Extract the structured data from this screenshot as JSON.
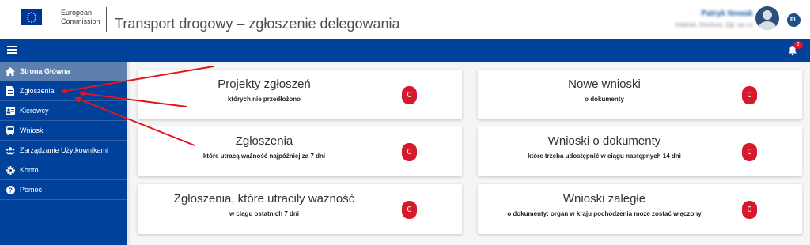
{
  "header": {
    "org_line1": "European",
    "org_line2": "Commission",
    "title": "Transport drogowy – zgłoszenie delegowania",
    "user_name": "Patryk Nowak",
    "user_sub": "Imbirek, Kierkow, Zgl. se.r.o",
    "language": "PL"
  },
  "topbar": {
    "notification_count": "2"
  },
  "sidebar": {
    "items": [
      {
        "label": "Strona Główna",
        "icon": "home-icon"
      },
      {
        "label": "Zgłoszenia",
        "icon": "document-icon"
      },
      {
        "label": "Kierowcy",
        "icon": "id-card-icon"
      },
      {
        "label": "Wnioski",
        "icon": "bus-icon"
      },
      {
        "label": "Zarządzanie Użytkownikami",
        "icon": "users-icon"
      },
      {
        "label": "Konto",
        "icon": "gear-icon"
      },
      {
        "label": "Pomoc",
        "icon": "help-icon"
      }
    ]
  },
  "cards": [
    {
      "title": "Projekty zgłoszeń",
      "sub": "których nie przedłożono",
      "count": "0"
    },
    {
      "title": "Nowe wnioski",
      "sub": "o dokumenty",
      "count": "0"
    },
    {
      "title": "Zgłoszenia",
      "sub": "które utracą ważność najpóźniej za 7 dni",
      "count": "0"
    },
    {
      "title": "Wnioski o dokumenty",
      "sub": "które trzeba udostępnić w ciągu następnych 14 dni",
      "count": "0"
    },
    {
      "title": "Zgłoszenia, które utraciły ważność",
      "sub": "w ciągu ostatnich 7 dni",
      "count": "0"
    },
    {
      "title": "Wnioski zaległe",
      "sub": "o dokumenty: organ w kraju pochodzenia może zostać włączony",
      "count": "0"
    }
  ],
  "colors": {
    "brand_blue": "#00419b",
    "active_item": "#5c7fad",
    "badge_red": "#d7192c",
    "annotation_red": "#e0161c"
  }
}
